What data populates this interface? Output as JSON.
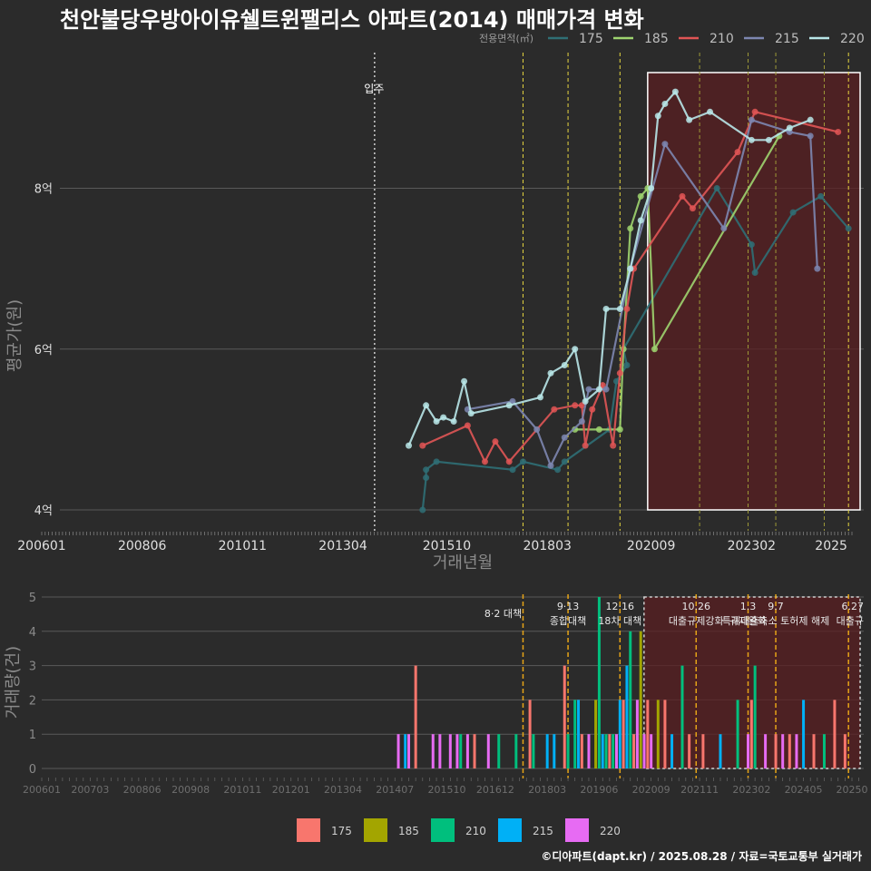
{
  "chart_data": [
    {
      "type": "line",
      "title": "천안불당우방아이유쉘트윈팰리스 아파트(2014) 매매가격 변화",
      "xlabel": "거래년월",
      "ylabel": "평균가(원)",
      "legend_title": "전용면적(㎡)",
      "legend_position": "top-right",
      "ylim": [
        3.8,
        9.6
      ],
      "y_ticks": [
        {
          "v": 4,
          "label": "4억"
        },
        {
          "v": 6,
          "label": "6억"
        },
        {
          "v": 8,
          "label": "8억"
        }
      ],
      "x_ticks": [
        "200601",
        "200806",
        "201011",
        "201304",
        "201510",
        "201803",
        "202009",
        "202302",
        "2025"
      ],
      "grid": true,
      "annotations": [
        {
          "label": "입주",
          "x": "2014-01"
        }
      ],
      "series": [
        {
          "name": "175",
          "color": "#2f6f75",
          "points": [
            [
              "2015-03",
              4.0
            ],
            [
              "2015-04",
              4.4
            ],
            [
              "2015-04",
              4.5
            ],
            [
              "2015-07",
              4.6
            ],
            [
              "2017-05",
              4.5
            ],
            [
              "2017-08",
              4.6
            ],
            [
              "2018-06",
              4.5
            ],
            [
              "2018-08",
              4.6
            ],
            [
              "2019-09",
              5.0
            ],
            [
              "2019-11",
              5.6
            ],
            [
              "2020-02",
              5.8
            ],
            [
              "2020-01",
              6.0
            ],
            [
              "2022-04",
              8.0
            ],
            [
              "2023-02",
              7.3
            ],
            [
              "2023-03",
              6.95
            ],
            [
              "2024-02",
              7.7
            ],
            [
              "2024-10",
              7.9
            ],
            [
              "2025-06",
              7.5
            ]
          ]
        },
        {
          "name": "185",
          "color": "#9ed46f",
          "points": [
            [
              "2018-11",
              5.0
            ],
            [
              "2019-06",
              5.0
            ],
            [
              "2019-12",
              5.0
            ],
            [
              "2020-01",
              6.0
            ],
            [
              "2020-03",
              7.5
            ],
            [
              "2020-06",
              7.9
            ],
            [
              "2020-08",
              8.0
            ],
            [
              "2020-10",
              6.0
            ],
            [
              "2023-10",
              8.65
            ]
          ]
        },
        {
          "name": "210",
          "color": "#e05555",
          "points": [
            [
              "2015-03",
              4.8
            ],
            [
              "2016-04",
              5.05
            ],
            [
              "2016-09",
              4.6
            ],
            [
              "2016-12",
              4.85
            ],
            [
              "2017-04",
              4.6
            ],
            [
              "2018-05",
              5.25
            ],
            [
              "2018-11",
              5.3
            ],
            [
              "2019-01",
              5.3
            ],
            [
              "2019-02",
              4.8
            ],
            [
              "2019-04",
              5.25
            ],
            [
              "2019-07",
              5.55
            ],
            [
              "2019-10",
              4.8
            ],
            [
              "2019-12",
              5.7
            ],
            [
              "2020-02",
              6.5
            ],
            [
              "2020-04",
              7.0
            ],
            [
              "2021-06",
              7.9
            ],
            [
              "2021-09",
              7.75
            ],
            [
              "2022-10",
              8.45
            ],
            [
              "2023-03",
              8.95
            ],
            [
              "2025-03",
              8.7
            ]
          ]
        },
        {
          "name": "215",
          "color": "#7d86b0",
          "points": [
            [
              "2016-04",
              5.25
            ],
            [
              "2017-05",
              5.35
            ],
            [
              "2017-12",
              5.0
            ],
            [
              "2018-04",
              4.55
            ],
            [
              "2018-08",
              4.9
            ],
            [
              "2019-01",
              5.1
            ],
            [
              "2019-03",
              5.5
            ],
            [
              "2019-08",
              5.5
            ],
            [
              "2020-03",
              7.0
            ],
            [
              "2021-01",
              8.55
            ],
            [
              "2022-06",
              7.5
            ],
            [
              "2023-02",
              8.85
            ],
            [
              "2024-01",
              8.7
            ],
            [
              "2024-07",
              8.65
            ],
            [
              "2024-09",
              7.0
            ]
          ]
        },
        {
          "name": "220",
          "color": "#b8e6e8",
          "points": [
            [
              "2014-11",
              4.8
            ],
            [
              "2015-04",
              5.3
            ],
            [
              "2015-07",
              5.1
            ],
            [
              "2015-09",
              5.15
            ],
            [
              "2015-12",
              5.1
            ],
            [
              "2016-03",
              5.6
            ],
            [
              "2016-05",
              5.2
            ],
            [
              "2017-04",
              5.3
            ],
            [
              "2018-01",
              5.4
            ],
            [
              "2018-04",
              5.7
            ],
            [
              "2018-08",
              5.8
            ],
            [
              "2018-11",
              6.0
            ],
            [
              "2019-02",
              5.35
            ],
            [
              "2019-06",
              5.5
            ],
            [
              "2019-08",
              6.5
            ],
            [
              "2019-12",
              6.5
            ],
            [
              "2020-03",
              7.0
            ],
            [
              "2020-06",
              7.6
            ],
            [
              "2020-09",
              8.0
            ],
            [
              "2020-11",
              8.9
            ],
            [
              "2021-01",
              9.05
            ],
            [
              "2021-04",
              9.2
            ],
            [
              "2021-08",
              8.85
            ],
            [
              "2022-02",
              8.95
            ],
            [
              "2023-02",
              8.6
            ],
            [
              "2023-07",
              8.6
            ],
            [
              "2024-01",
              8.75
            ],
            [
              "2024-07",
              8.85
            ]
          ]
        }
      ],
      "policy_lines": [
        {
          "x": "2017-08",
          "color": "#e6d640",
          "style": "dashed"
        },
        {
          "x": "2018-09",
          "color": "#e6d640",
          "style": "dashed"
        },
        {
          "x": "2019-12",
          "color": "#e6d640",
          "style": "dashed"
        },
        {
          "x": "2021-11",
          "color": "#9e9a38",
          "style": "dashed"
        },
        {
          "x": "2023-01",
          "color": "#9e9a38",
          "style": "dashed"
        },
        {
          "x": "2023-09",
          "color": "#9e9a38",
          "style": "dashed"
        },
        {
          "x": "2024-11",
          "color": "#9e9a38",
          "style": "dashed"
        },
        {
          "x": "2025-06",
          "color": "#e6d640",
          "style": "dashed"
        }
      ],
      "highlight_range": [
        "2020-08",
        "2025-08"
      ]
    },
    {
      "type": "bar",
      "ylabel": "거래량(건)",
      "ylim": [
        0,
        5
      ],
      "y_ticks": [
        0,
        1,
        2,
        3,
        4,
        5
      ],
      "x_ticks": [
        "200601",
        "200703",
        "200806",
        "200908",
        "201011",
        "201201",
        "201304",
        "201407",
        "201510",
        "201612",
        "201803",
        "201906",
        "202009",
        "202111",
        "202302",
        "202405",
        "20250"
      ],
      "series_colors": {
        "175": "#f8766d",
        "185": "#a3a500",
        "210": "#00bf7d",
        "215": "#00b0f6",
        "220": "#e76bf3"
      },
      "bars": [
        {
          "x": "2014-08",
          "s": "220",
          "v": 1
        },
        {
          "x": "2014-10",
          "s": "215",
          "v": 1
        },
        {
          "x": "2014-11",
          "s": "220",
          "v": 1
        },
        {
          "x": "2015-01",
          "s": "175",
          "v": 3
        },
        {
          "x": "2015-06",
          "s": "220",
          "v": 1
        },
        {
          "x": "2015-08",
          "s": "220",
          "v": 1
        },
        {
          "x": "2015-11",
          "s": "220",
          "v": 1
        },
        {
          "x": "2016-01",
          "s": "220",
          "v": 1
        },
        {
          "x": "2016-02",
          "s": "210",
          "v": 1
        },
        {
          "x": "2016-04",
          "s": "220",
          "v": 1
        },
        {
          "x": "2016-06",
          "s": "175",
          "v": 1
        },
        {
          "x": "2016-10",
          "s": "220",
          "v": 1
        },
        {
          "x": "2017-01",
          "s": "210",
          "v": 1
        },
        {
          "x": "2017-06",
          "s": "210",
          "v": 1
        },
        {
          "x": "2017-10",
          "s": "175",
          "v": 2
        },
        {
          "x": "2017-11",
          "s": "210",
          "v": 1
        },
        {
          "x": "2018-03",
          "s": "215",
          "v": 1
        },
        {
          "x": "2018-05",
          "s": "215",
          "v": 1
        },
        {
          "x": "2018-08",
          "s": "175",
          "v": 3
        },
        {
          "x": "2018-09",
          "s": "210",
          "v": 1
        },
        {
          "x": "2018-11",
          "s": "210",
          "v": 2
        },
        {
          "x": "2018-12",
          "s": "215",
          "v": 2
        },
        {
          "x": "2019-01",
          "s": "175",
          "v": 1
        },
        {
          "x": "2019-03",
          "s": "220",
          "v": 1
        },
        {
          "x": "2019-05",
          "s": "185",
          "v": 2
        },
        {
          "x": "2019-06",
          "s": "210",
          "v": 5
        },
        {
          "x": "2019-07",
          "s": "215",
          "v": 1
        },
        {
          "x": "2019-08",
          "s": "210",
          "v": 1
        },
        {
          "x": "2019-09",
          "s": "175",
          "v": 1
        },
        {
          "x": "2019-10",
          "s": "210",
          "v": 1
        },
        {
          "x": "2019-11",
          "s": "220",
          "v": 1
        },
        {
          "x": "2019-12",
          "s": "215",
          "v": 2
        },
        {
          "x": "2020-01",
          "s": "175",
          "v": 2
        },
        {
          "x": "2020-02",
          "s": "215",
          "v": 3
        },
        {
          "x": "2020-03",
          "s": "210",
          "v": 4
        },
        {
          "x": "2020-04",
          "s": "175",
          "v": 1
        },
        {
          "x": "2020-05",
          "s": "220",
          "v": 2
        },
        {
          "x": "2020-06",
          "s": "185",
          "v": 4
        },
        {
          "x": "2020-07",
          "s": "220",
          "v": 1
        },
        {
          "x": "2020-08",
          "s": "175",
          "v": 2
        },
        {
          "x": "2020-09",
          "s": "220",
          "v": 1
        },
        {
          "x": "2020-11",
          "s": "185",
          "v": 2
        },
        {
          "x": "2021-01",
          "s": "175",
          "v": 2
        },
        {
          "x": "2021-03",
          "s": "215",
          "v": 1
        },
        {
          "x": "2021-06",
          "s": "210",
          "v": 3
        },
        {
          "x": "2021-08",
          "s": "175",
          "v": 1
        },
        {
          "x": "2021-12",
          "s": "175",
          "v": 1
        },
        {
          "x": "2022-05",
          "s": "215",
          "v": 1
        },
        {
          "x": "2022-10",
          "s": "210",
          "v": 2
        },
        {
          "x": "2023-01",
          "s": "220",
          "v": 1
        },
        {
          "x": "2023-02",
          "s": "175",
          "v": 2
        },
        {
          "x": "2023-03",
          "s": "210",
          "v": 3
        },
        {
          "x": "2023-06",
          "s": "220",
          "v": 1
        },
        {
          "x": "2023-09",
          "s": "175",
          "v": 1
        },
        {
          "x": "2023-11",
          "s": "220",
          "v": 1
        },
        {
          "x": "2024-01",
          "s": "175",
          "v": 1
        },
        {
          "x": "2024-03",
          "s": "220",
          "v": 1
        },
        {
          "x": "2024-05",
          "s": "215",
          "v": 2
        },
        {
          "x": "2024-08",
          "s": "175",
          "v": 1
        },
        {
          "x": "2024-11",
          "s": "210",
          "v": 1
        },
        {
          "x": "2025-02",
          "s": "175",
          "v": 2
        },
        {
          "x": "2025-05",
          "s": "175",
          "v": 1
        }
      ],
      "policy_notes": [
        {
          "x": "2017-08",
          "lines": [
            "8·2 대책"
          ]
        },
        {
          "x": "2018-09",
          "lines": [
            "9·13",
            "종합대책"
          ]
        },
        {
          "x": "2019-12",
          "lines": [
            "12·16",
            "18차 대책"
          ]
        },
        {
          "x": "2021-10",
          "lines": [
            "10.26",
            "대출규제강화"
          ]
        },
        {
          "x": "2023-01",
          "lines": [
            "1.3",
            "규제완화"
          ]
        },
        {
          "x": "2023-09",
          "lines": [
            "9.7",
            "특례대출축소 토허제 해제"
          ]
        },
        {
          "x": "2025-06",
          "lines": [
            "6.27",
            "대출규"
          ]
        }
      ]
    }
  ],
  "legend": {
    "items": [
      {
        "label": "175",
        "color": "#f8766d"
      },
      {
        "label": "185",
        "color": "#a3a500"
      },
      {
        "label": "210",
        "color": "#00bf7d"
      },
      {
        "label": "215",
        "color": "#00b0f6"
      },
      {
        "label": "220",
        "color": "#e76bf3"
      }
    ]
  },
  "footer": {
    "credit": "©디아파트(dapt.kr) / 2025.08.28 / 자료=국토교통부 실거래가"
  }
}
